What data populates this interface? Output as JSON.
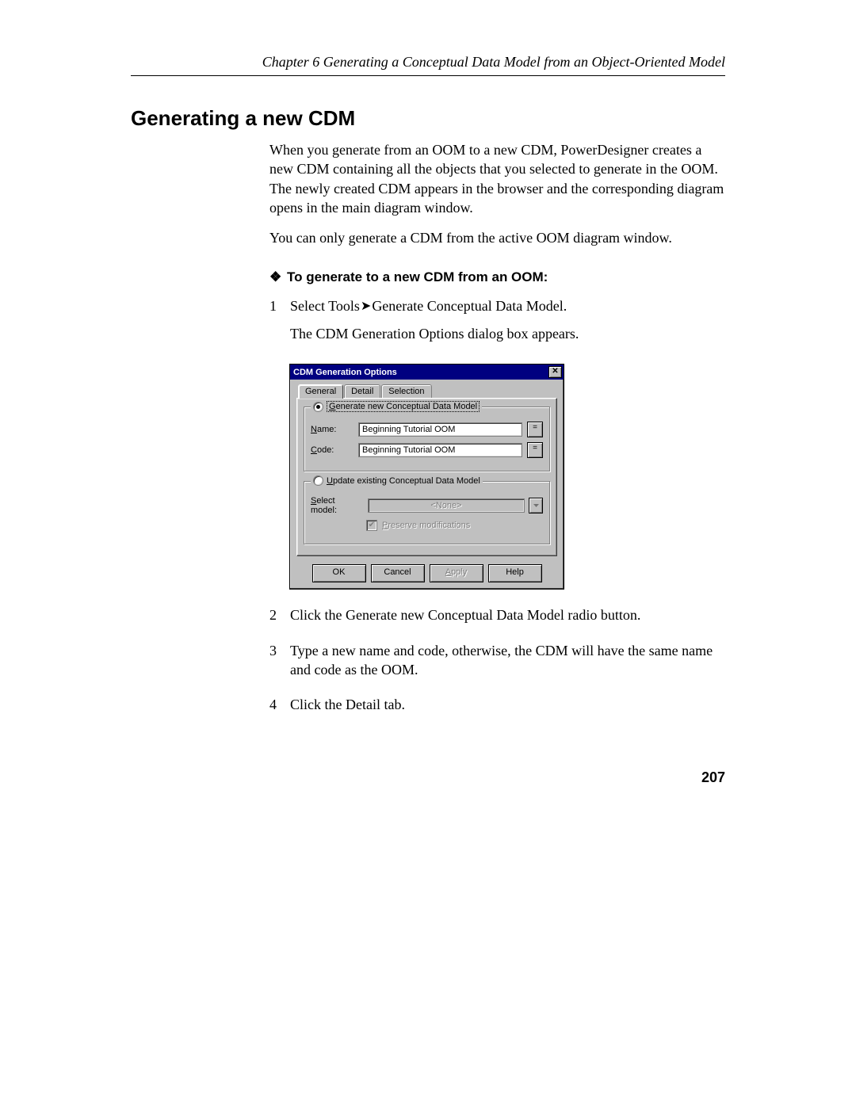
{
  "header": {
    "chapter": "Chapter 6    Generating a Conceptual Data Model from an Object-Oriented Model"
  },
  "section_title": "Generating a new CDM",
  "paragraphs": {
    "p1": "When you generate from an OOM to a new CDM, PowerDesigner creates a new CDM containing all the objects that you selected to generate in the OOM. The newly created CDM appears in the browser and the corresponding diagram opens in the main diagram window.",
    "p2": "You can only generate a CDM from the active OOM diagram window."
  },
  "procedure": {
    "title": "To generate to a new CDM from an OOM:",
    "steps": [
      {
        "num": "1",
        "line1_prefix": "Select Tools",
        "line1_suffix": "Generate Conceptual Data Model.",
        "line2": "The CDM Generation Options dialog box appears."
      },
      {
        "num": "2",
        "text": "Click the Generate new Conceptual Data Model radio button."
      },
      {
        "num": "3",
        "text": "Type a new name and code, otherwise, the CDM will have the same name and code as the OOM."
      },
      {
        "num": "4",
        "text": "Click the Detail tab."
      }
    ]
  },
  "dialog": {
    "title": "CDM Generation Options",
    "tabs": {
      "general": "General",
      "detail": "Detail",
      "selection": "Selection"
    },
    "group1": {
      "legend_u": "G",
      "legend_rest": "enerate new Conceptual Data Model",
      "name_label_u": "N",
      "name_label_rest": "ame:",
      "name_value": "Beginning Tutorial OOM",
      "code_label_u": "C",
      "code_label_rest": "ode:",
      "code_value": "Beginning Tutorial OOM",
      "eq_btn": "="
    },
    "group2": {
      "legend_u": "U",
      "legend_rest": "pdate existing Conceptual Data Model",
      "select_label_u": "S",
      "select_label_rest": "elect model:",
      "select_value": "<None>",
      "preserve_u": "P",
      "preserve_rest": "reserve modifications"
    },
    "buttons": {
      "ok": "OK",
      "cancel": "Cancel",
      "apply": "Apply",
      "help": "Help"
    }
  },
  "page_number": "207"
}
